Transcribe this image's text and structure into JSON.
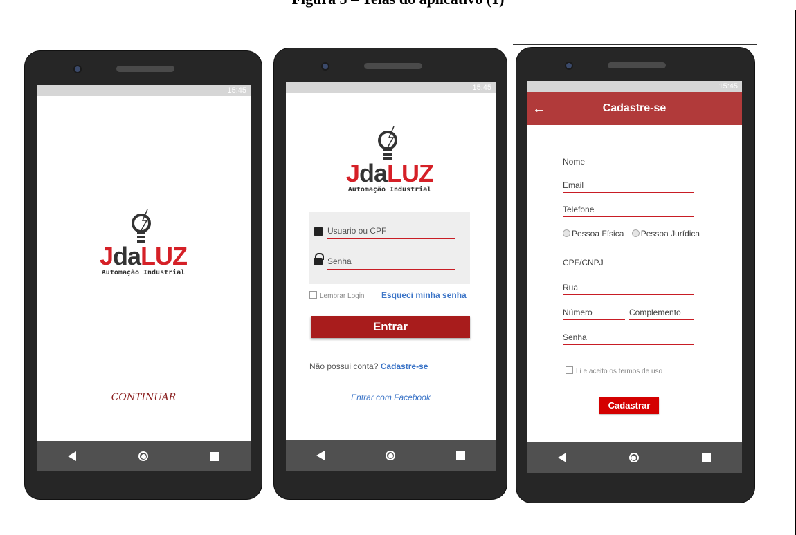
{
  "caption": "Figura 5 – Telas do aplicativo (1)",
  "status_time": "15:45",
  "logo": {
    "word_j": "J",
    "word_da": "da",
    "word_luz": "LUZ",
    "subtitle": "Automação Industrial"
  },
  "splash": {
    "continue_label": "CONTINUAR"
  },
  "login": {
    "user_placeholder": "Usuario ou CPF",
    "password_placeholder": "Senha",
    "remember_label": "Lembrar Login",
    "forgot_label": "Esqueci minha senha",
    "enter_label": "Entrar",
    "no_account_label": "Não possui conta?",
    "signup_label": "Cadastre-se",
    "facebook_label": "Entrar com Facebook"
  },
  "signup": {
    "title": "Cadastre-se",
    "name": "Nome",
    "email": "Email",
    "phone": "Telefone",
    "pf": "Pessoa Física",
    "pj": "Pessoa Jurídica",
    "doc": "CPF/CNPJ",
    "street": "Rua",
    "number": "Número",
    "complement": "Complemento",
    "password": "Senha",
    "terms": "Li e aceito os termos de uso",
    "submit": "Cadastrar"
  },
  "icons": {
    "back": "arrow-left-icon",
    "nav": [
      "nav-back-icon",
      "nav-home-icon",
      "nav-recent-icon"
    ]
  },
  "colors": {
    "brand_red": "#d52027",
    "appbar": "#b13a3a",
    "button": "#a81c1c",
    "link": "#3b74c7"
  }
}
